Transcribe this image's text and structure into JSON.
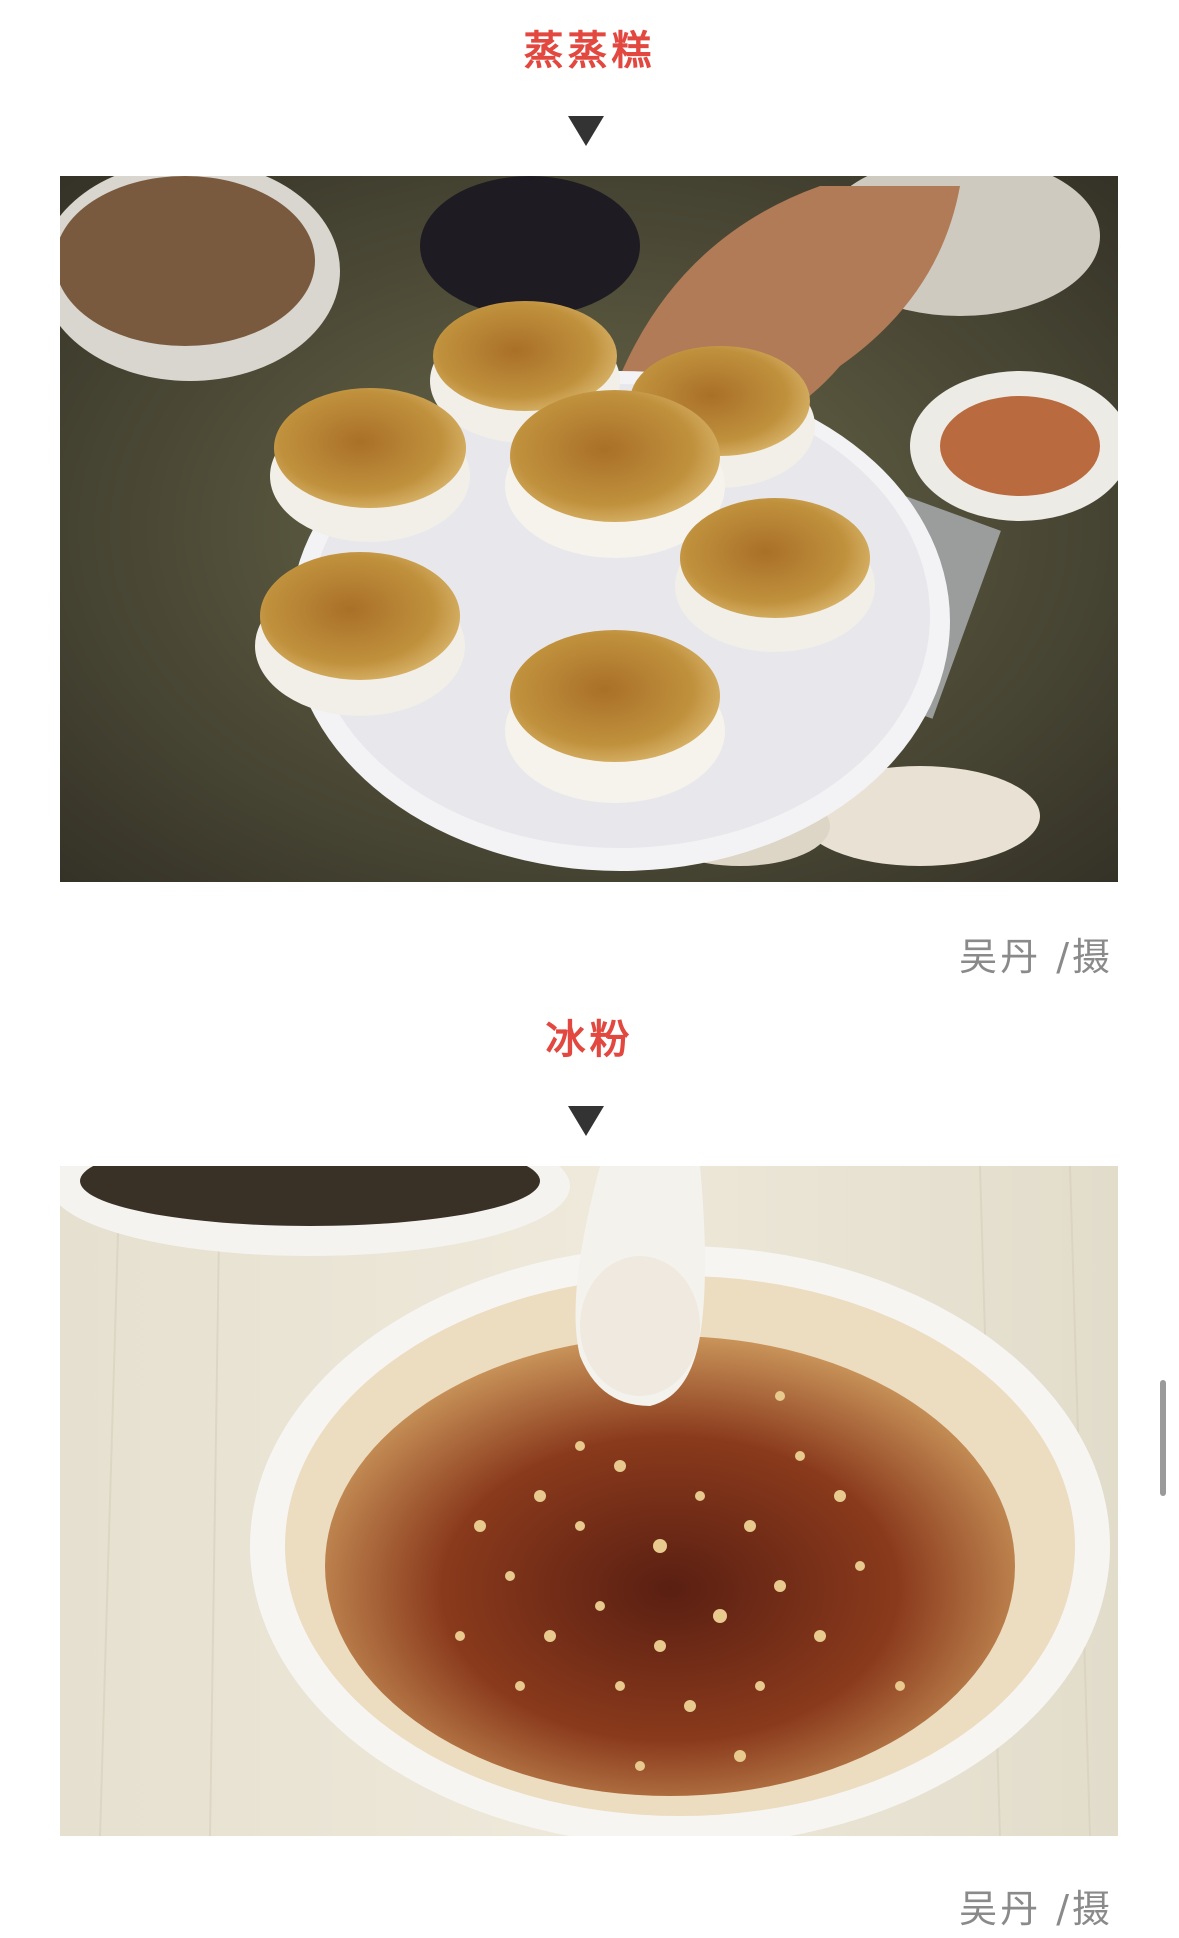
{
  "sections": [
    {
      "title": "蒸蒸糕",
      "image_alt": "steamed cakes topped with brown sugar and sesame on a white plate",
      "credit": "吴丹 /摄"
    },
    {
      "title": "冰粉",
      "image_alt": "bowl of ice jelly with brown syrup, crushed peanuts and sesame",
      "credit": "吴丹 /摄"
    }
  ],
  "colors": {
    "title": "#e2483f",
    "arrow": "#333333",
    "credit": "#8a8a8a"
  },
  "icons": [
    "down-triangle-icon"
  ]
}
